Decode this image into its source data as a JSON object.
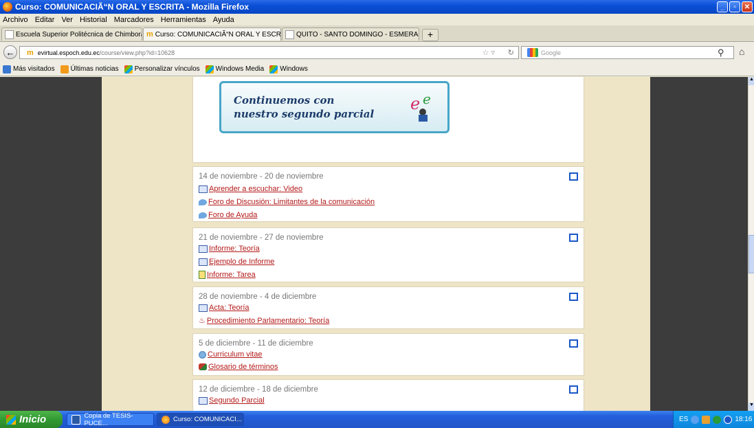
{
  "window": {
    "title": "Curso: COMUNICACIÃ“N ORAL Y ESCRITA - Mozilla Firefox"
  },
  "menu": [
    "Archivo",
    "Editar",
    "Ver",
    "Historial",
    "Marcadores",
    "Herramientas",
    "Ayuda"
  ],
  "tabs": [
    {
      "label": "Escuela Superior Politécnica de Chimborazo",
      "close": "×"
    },
    {
      "label": "Curso: COMUNICACIÃ“N ORAL Y ESCRITA",
      "close": "×"
    },
    {
      "label": "QUITO - SANTO DOMINGO - ESMERALDA...",
      "close": "×"
    }
  ],
  "newtab": "+",
  "nav": {
    "url_domain": "evirtual.espoch.edu.ec",
    "url_path": "/course/view.php?id=10628",
    "search_placeholder": "Google"
  },
  "bookmarks": [
    "Más visitados",
    "Últimas noticias",
    "Personalizar vínculos",
    "Windows Media",
    "Windows"
  ],
  "banner": {
    "line1": "Continuemos con",
    "line2": "nuestro segundo parcial"
  },
  "sections": [
    {
      "title": "14 de noviembre - 20 de noviembre",
      "items": [
        {
          "icon": "page",
          "label": "Aprender a escuchar: Video"
        },
        {
          "icon": "forum",
          "label": " Foro de Discusión: Limitantes de la comunicación"
        },
        {
          "icon": "forum",
          "label": " Foro de Ayuda"
        }
      ]
    },
    {
      "title": "21 de noviembre - 27 de noviembre",
      "items": [
        {
          "icon": "page",
          "label": "Informe: Teoría"
        },
        {
          "icon": "page",
          "label": "Ejemplo de Informe"
        },
        {
          "icon": "assign",
          "label": "Informe: Tarea"
        }
      ]
    },
    {
      "title": "28 de noviembre - 4 de diciembre",
      "items": [
        {
          "icon": "page",
          "label": "Acta: Teoría"
        },
        {
          "icon": "pdf",
          "label": " Procedimiento Parlamentario: Teoría"
        }
      ]
    },
    {
      "title": "5 de diciembre - 11 de diciembre",
      "items": [
        {
          "icon": "cv",
          "label": " Curriculum vitae"
        },
        {
          "icon": "gloss",
          "label": "Glosario de términos"
        }
      ]
    },
    {
      "title": "12 de diciembre - 18 de diciembre",
      "items": [
        {
          "icon": "page",
          "label": "Segundo Parcial"
        }
      ]
    }
  ],
  "taskbar": {
    "start": "Inicio",
    "tasks": [
      "Copia de TESIS-PUCE...",
      "Curso: COMUNICACI..."
    ],
    "lang": "ES",
    "clock": "18:16"
  }
}
